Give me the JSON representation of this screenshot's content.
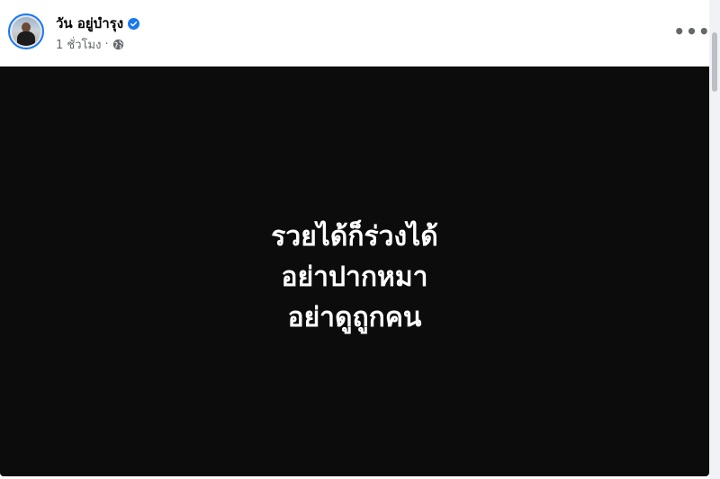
{
  "post": {
    "author_name": "วัน อยู่บำรุง",
    "verified": true,
    "timestamp": "1 ชั่วโมง",
    "separator": "·",
    "audience_icon": "globe-icon",
    "more_label": "•••"
  },
  "image_text": {
    "lines": [
      "รวยได้ก็ร่วงได้",
      "อย่าปากหมา",
      "อย่าดูถูกคน"
    ]
  },
  "colors": {
    "accent": "#1877f2",
    "image_background": "#0c0c0c",
    "secondary_text": "#65676b"
  }
}
